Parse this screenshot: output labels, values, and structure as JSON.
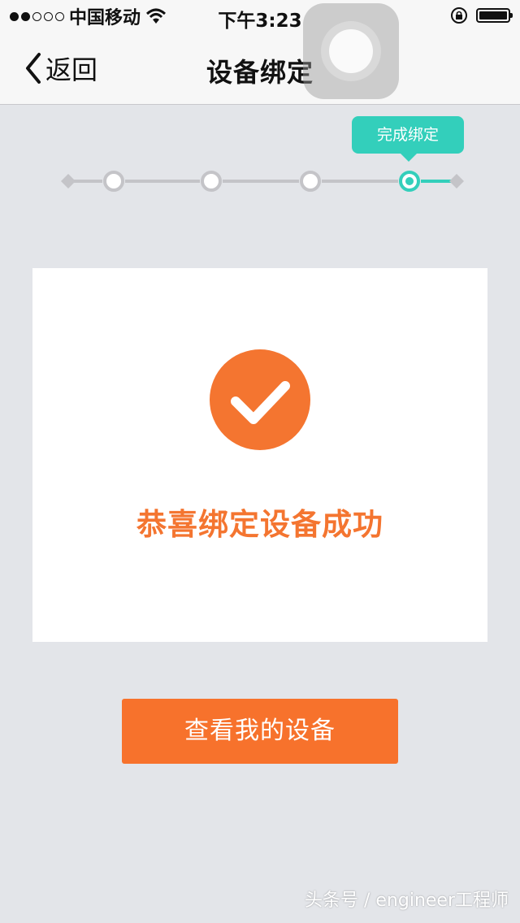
{
  "status_bar": {
    "carrier": "中国移动",
    "time": "下午3:23",
    "signal_filled": 2,
    "signal_total": 5,
    "battery_level": 1.0
  },
  "nav": {
    "back_label": "返回",
    "title": "设备绑定",
    "back_icon": "chevron-left-icon"
  },
  "stepper": {
    "steps": 4,
    "current_step": 4,
    "tooltip": "完成绑定",
    "active_color": "#33cfbb",
    "inactive_color": "#c4c4c8"
  },
  "success": {
    "icon": "checkmark-icon",
    "message": "恭喜绑定设备成功",
    "accent_color": "#f47530"
  },
  "actions": {
    "view_devices_label": "查看我的设备"
  },
  "watermark": {
    "text": "头条号 / engineer工程师"
  }
}
